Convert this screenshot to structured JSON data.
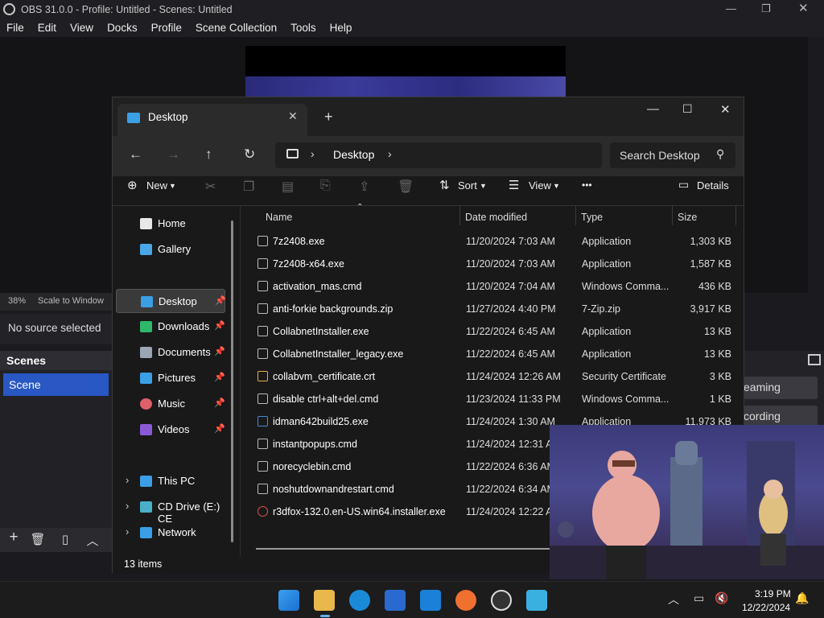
{
  "obs": {
    "title": "OBS 31.0.0 - Profile: Untitled - Scenes: Untitled",
    "menu": [
      "File",
      "Edit",
      "View",
      "Docks",
      "Profile",
      "Scene Collection",
      "Tools",
      "Help"
    ],
    "zoom": "38%",
    "scale_label": "Scale to Window",
    "no_source": "No source selected",
    "scenes_header": "Scenes",
    "scene_item": "Scene",
    "streaming_label": "eaming",
    "recording_label": "cording"
  },
  "explorer": {
    "tab_label": "Desktop",
    "address": [
      "Desktop"
    ],
    "search_placeholder": "Search Desktop",
    "toolbar": {
      "new": "New",
      "sort": "Sort",
      "view": "View",
      "more": "•••",
      "details": "Details"
    },
    "sidebar": [
      {
        "label": "Home",
        "icon": "home-icon",
        "pinned": false
      },
      {
        "label": "Gallery",
        "icon": "gallery-icon",
        "pinned": false
      },
      {
        "label": "Desktop",
        "icon": "desktop-folder-icon",
        "pinned": true,
        "selected": true
      },
      {
        "label": "Downloads",
        "icon": "downloads-icon",
        "pinned": true
      },
      {
        "label": "Documents",
        "icon": "documents-icon",
        "pinned": true
      },
      {
        "label": "Pictures",
        "icon": "pictures-icon",
        "pinned": true
      },
      {
        "label": "Music",
        "icon": "music-icon",
        "pinned": true
      },
      {
        "label": "Videos",
        "icon": "videos-icon",
        "pinned": true
      },
      {
        "label": "This PC",
        "icon": "pc-icon",
        "expandable": true
      },
      {
        "label": "CD Drive (E:) CE",
        "icon": "cd-drive-icon",
        "expandable": true
      },
      {
        "label": "Network",
        "icon": "network-icon",
        "expandable": true
      }
    ],
    "columns": [
      "Name",
      "Date modified",
      "Type",
      "Size"
    ],
    "files": [
      {
        "name": "7z2408.exe",
        "date": "11/20/2024 7:03 AM",
        "type": "Application",
        "size": "1,303 KB"
      },
      {
        "name": "7z2408-x64.exe",
        "date": "11/20/2024 7:03 AM",
        "type": "Application",
        "size": "1,587 KB"
      },
      {
        "name": "activation_mas.cmd",
        "date": "11/20/2024 7:04 AM",
        "type": "Windows Comma...",
        "size": "436 KB"
      },
      {
        "name": "anti-forkie backgrounds.zip",
        "date": "11/27/2024 4:40 PM",
        "type": "7-Zip.zip",
        "size": "3,917 KB"
      },
      {
        "name": "CollabnetInstaller.exe",
        "date": "11/22/2024 6:45 AM",
        "type": "Application",
        "size": "13 KB"
      },
      {
        "name": "CollabnetInstaller_legacy.exe",
        "date": "11/22/2024 6:45 AM",
        "type": "Application",
        "size": "13 KB"
      },
      {
        "name": "collabvm_certificate.crt",
        "date": "11/24/2024 12:26 AM",
        "type": "Security Certificate",
        "size": "3 KB"
      },
      {
        "name": "disable ctrl+alt+del.cmd",
        "date": "11/23/2024 11:33 PM",
        "type": "Windows Comma...",
        "size": "1 KB"
      },
      {
        "name": "idman642build25.exe",
        "date": "11/24/2024 1:30 AM",
        "type": "Application",
        "size": "11,973 KB"
      },
      {
        "name": "instantpopups.cmd",
        "date": "11/24/2024 12:31 AM",
        "type": "",
        "size": ""
      },
      {
        "name": "norecyclebin.cmd",
        "date": "11/22/2024 6:36 AM",
        "type": "",
        "size": ""
      },
      {
        "name": "noshutdownandrestart.cmd",
        "date": "11/22/2024 6:34 AM",
        "type": "",
        "size": ""
      },
      {
        "name": "r3dfox-132.0.en-US.win64.installer.exe",
        "date": "11/24/2024 12:22 AM",
        "type": "",
        "size": ""
      }
    ],
    "status": "13 items"
  },
  "taskbar": {
    "apps": [
      "start-icon",
      "file-explorer-icon",
      "edge-icon",
      "store-icon",
      "outlook-icon",
      "firefox-icon",
      "obs-icon",
      "notepad-icon"
    ],
    "time": "3:19 PM",
    "date": "12/22/2024"
  }
}
